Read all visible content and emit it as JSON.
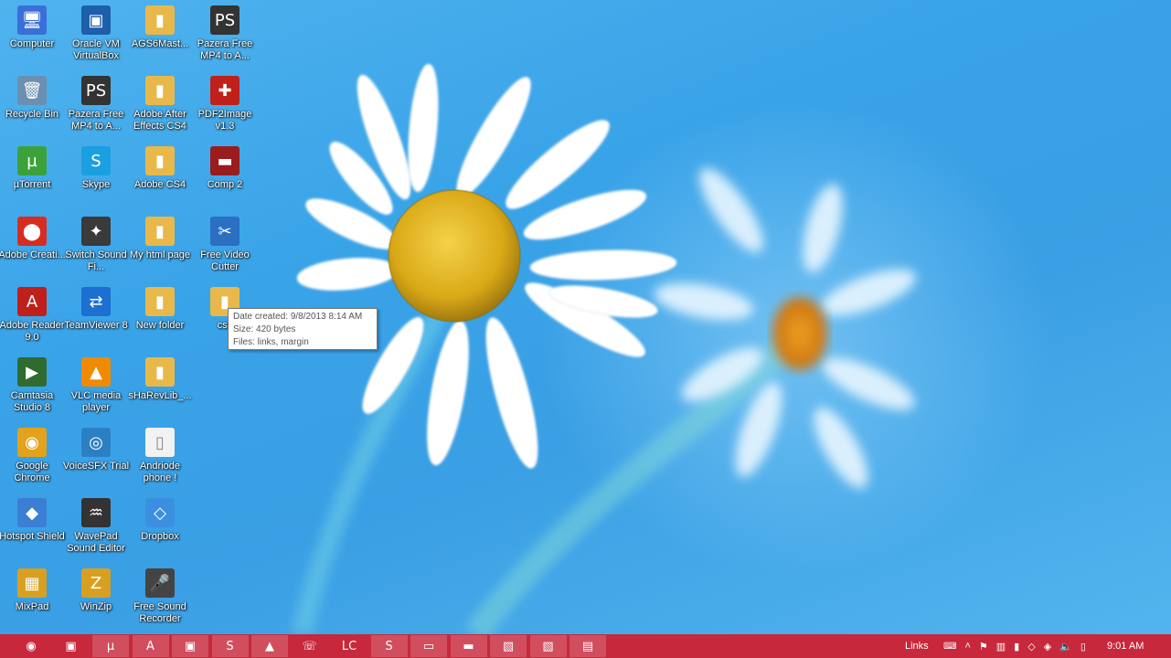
{
  "desktop": {
    "icons": [
      {
        "label": "Computer",
        "icon": "computer-icon",
        "glyph": "🖥",
        "color": "#3a6fd8"
      },
      {
        "label": "Recycle Bin",
        "icon": "recycle-bin-icon",
        "glyph": "🗑",
        "color": "#6b8fb0"
      },
      {
        "label": "µTorrent",
        "icon": "utorrent-icon",
        "glyph": "µ",
        "color": "#3ba23b"
      },
      {
        "label": "Adobe Creati...",
        "icon": "adobe-creative-icon",
        "glyph": "⬤",
        "color": "#d62d20"
      },
      {
        "label": "Adobe Reader 9.0",
        "icon": "adobe-reader-icon",
        "glyph": "A",
        "color": "#c0201a"
      },
      {
        "label": "Camtasia Studio 8",
        "icon": "camtasia-icon",
        "glyph": "▶",
        "color": "#2f6b2f"
      },
      {
        "label": "Google Chrome",
        "icon": "chrome-icon",
        "glyph": "◉",
        "color": "#e2a21b"
      },
      {
        "label": "Hotspot Shield",
        "icon": "hotspot-shield-icon",
        "glyph": "◆",
        "color": "#3b7fd4"
      },
      {
        "label": "MixPad",
        "icon": "mixpad-icon",
        "glyph": "▦",
        "color": "#d8a020"
      },
      {
        "label": "Oracle VM VirtualBox",
        "icon": "virtualbox-icon",
        "glyph": "▣",
        "color": "#1d5fa8"
      },
      {
        "label": "Pazera Free MP4 to A...",
        "icon": "pazera-icon",
        "glyph": "PS",
        "color": "#333333"
      },
      {
        "label": "Skype",
        "icon": "skype-icon",
        "glyph": "S",
        "color": "#1aa0e0"
      },
      {
        "label": "Switch Sound Fi...",
        "icon": "switch-sound-icon",
        "glyph": "✦",
        "color": "#3a3a3a"
      },
      {
        "label": "TeamViewer 8",
        "icon": "teamviewer-icon",
        "glyph": "⇄",
        "color": "#1d6fd1"
      },
      {
        "label": "VLC media player",
        "icon": "vlc-icon",
        "glyph": "▲",
        "color": "#f08a00"
      },
      {
        "label": "VoiceSFX Trial",
        "icon": "voicesfx-icon",
        "glyph": "◎",
        "color": "#2d7fc4"
      },
      {
        "label": "WavePad Sound Editor",
        "icon": "wavepad-icon",
        "glyph": "♒",
        "color": "#333333"
      },
      {
        "label": "WinZip",
        "icon": "winzip-icon",
        "glyph": "Z",
        "color": "#d8a020"
      },
      {
        "label": "AGS6Mast...",
        "icon": "folder-icon",
        "glyph": "▮",
        "color": "#e8b94a"
      },
      {
        "label": "Adobe After Effects CS4",
        "icon": "folder-icon",
        "glyph": "▮",
        "color": "#e8b94a"
      },
      {
        "label": "Adobe CS4",
        "icon": "folder-icon",
        "glyph": "▮",
        "color": "#e8b94a"
      },
      {
        "label": "My html page",
        "icon": "folder-icon",
        "glyph": "▮",
        "color": "#e8b94a"
      },
      {
        "label": "New folder",
        "icon": "folder-icon",
        "glyph": "▮",
        "color": "#e8b94a"
      },
      {
        "label": "sHaRevLib_...",
        "icon": "folder-icon",
        "glyph": "▮",
        "color": "#e8b94a"
      },
      {
        "label": "Andriode phone !",
        "icon": "document-icon",
        "glyph": "▯",
        "color": "#f2f2f2"
      },
      {
        "label": "Dropbox",
        "icon": "dropbox-icon",
        "glyph": "◇",
        "color": "#3b8fe0"
      },
      {
        "label": "Free Sound Recorder",
        "icon": "microphone-icon",
        "glyph": "🎤",
        "color": "#444444"
      },
      {
        "label": "Pazera Free MP4 to A...",
        "icon": "pazera-icon",
        "glyph": "PS",
        "color": "#333333"
      },
      {
        "label": "PDF2Image v1.3",
        "icon": "pdf2image-icon",
        "glyph": "✚",
        "color": "#c0201a"
      },
      {
        "label": "Comp 2",
        "icon": "video-icon",
        "glyph": "▬",
        "color": "#9b1c1c"
      },
      {
        "label": "Free Video Cutter",
        "icon": "scissors-icon",
        "glyph": "✂",
        "color": "#2a6fc2"
      },
      {
        "label": "css",
        "icon": "folder-icon",
        "glyph": "▮",
        "color": "#e8b94a"
      }
    ]
  },
  "tooltip": {
    "date": "Date created: 9/8/2013 8:14 AM",
    "size": "Size: 420 bytes",
    "files": "Files: links, margin"
  },
  "taskbar": {
    "color": "#c7283b",
    "buttons": [
      {
        "icon": "chrome-icon",
        "glyph": "◉"
      },
      {
        "icon": "app-icon",
        "glyph": "▣"
      },
      {
        "icon": "utorrent-icon",
        "glyph": "µ"
      },
      {
        "icon": "adobe-reader-icon",
        "glyph": "A"
      },
      {
        "icon": "virtualbox-icon",
        "glyph": "▣"
      },
      {
        "icon": "skype-icon",
        "glyph": "S"
      },
      {
        "icon": "vlc-icon",
        "glyph": "▲"
      },
      {
        "icon": "viber-icon",
        "glyph": "☏"
      },
      {
        "icon": "lc-icon",
        "glyph": "LC"
      },
      {
        "icon": "skype-icon",
        "glyph": "S"
      },
      {
        "icon": "remote-desktop-icon",
        "glyph": "▭"
      },
      {
        "icon": "file-explorer-icon",
        "glyph": "▬"
      },
      {
        "icon": "pdf-icon",
        "glyph": "▧"
      },
      {
        "icon": "pdf-icon",
        "glyph": "▧"
      },
      {
        "icon": "notepad-icon",
        "glyph": "▤"
      }
    ],
    "tray": {
      "links_label": "Links",
      "time": "9:01 AM"
    }
  }
}
